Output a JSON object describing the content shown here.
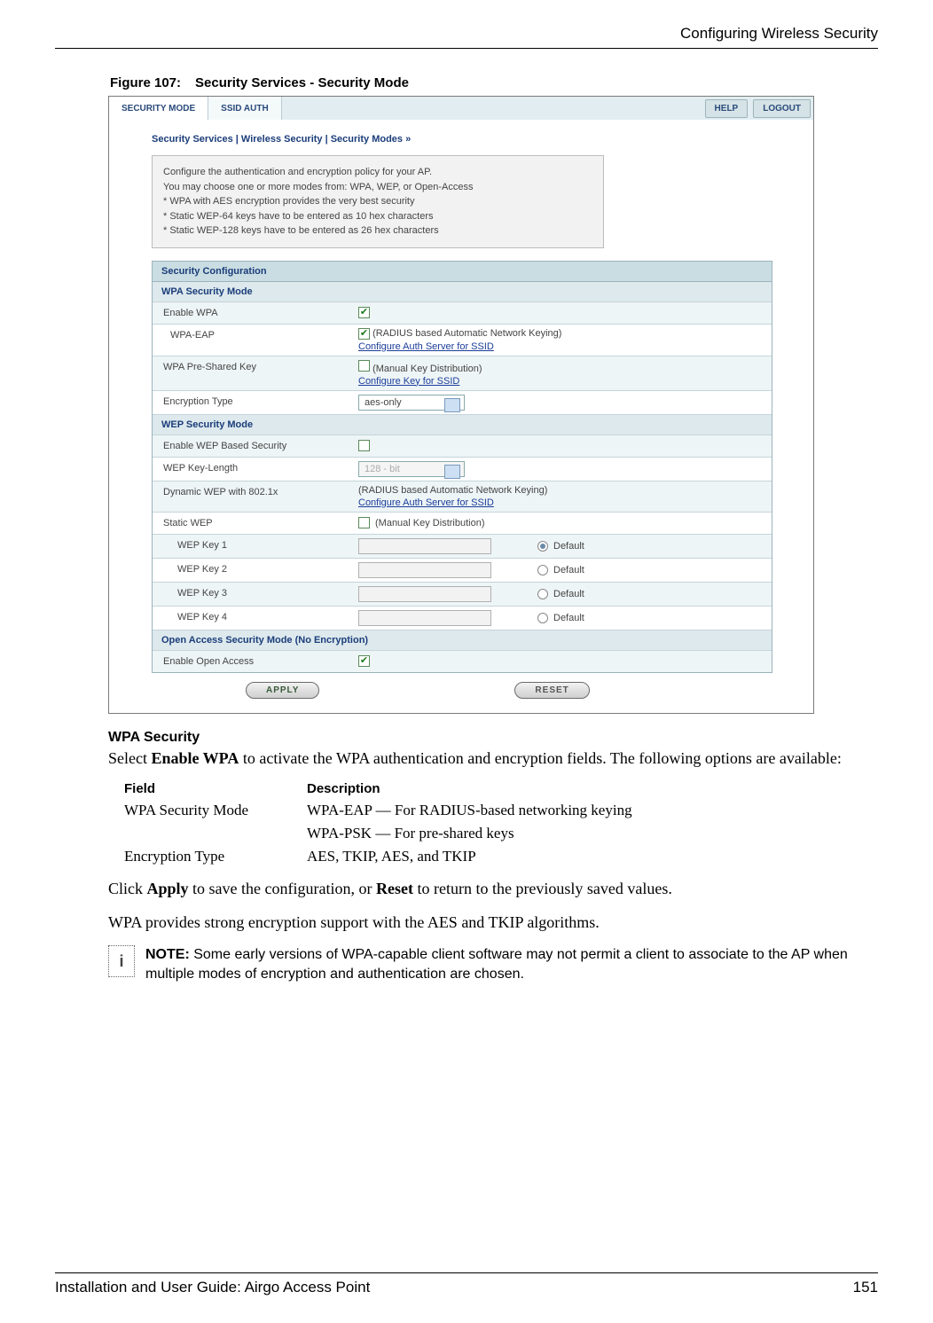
{
  "header": {
    "section_title": "Configuring Wireless Security"
  },
  "figure": {
    "label": "Figure 107:",
    "title": "Security Services - Security Mode"
  },
  "screenshot": {
    "tabs": {
      "active": "SECURITY MODE",
      "other": "SSID AUTH"
    },
    "topbuttons": {
      "help": "HELP",
      "logout": "LOGOUT"
    },
    "breadcrumb": "Security Services | Wireless Security | Security Modes  »",
    "info_lines": [
      "Configure the authentication and encryption policy for your AP.",
      "You may choose one or more modes from: WPA, WEP, or Open-Access",
      "* WPA with AES encryption provides the very best security",
      "* Static WEP-64 keys have to be entered as 10 hex characters",
      "* Static WEP-128 keys have to be entered as 26 hex characters"
    ],
    "hdr_main": "Security Configuration",
    "wpa": {
      "hdr": "WPA Security Mode",
      "enable_label": "Enable WPA",
      "eap_label": "WPA-EAP",
      "eap_note": "(RADIUS based Automatic Network Keying)",
      "eap_link": "Configure Auth Server for SSID",
      "psk_label": "WPA Pre-Shared Key",
      "psk_note": "(Manual Key Distribution)",
      "psk_link": "Configure Key for SSID",
      "enc_label": "Encryption Type",
      "enc_value": "aes-only"
    },
    "wep": {
      "hdr": "WEP Security Mode",
      "enable_label": "Enable WEP Based Security",
      "keylen_label": "WEP Key-Length",
      "keylen_value": "128 - bit",
      "dyn_label": "Dynamic WEP with 802.1x",
      "dyn_note": "(RADIUS based Automatic Network Keying)",
      "dyn_link": "Configure Auth Server for SSID",
      "static_label": "Static WEP",
      "static_note": "(Manual Key Distribution)",
      "k1": "WEP Key 1",
      "k2": "WEP Key 2",
      "k3": "WEP Key 3",
      "k4": "WEP Key 4",
      "default": "Default"
    },
    "open": {
      "hdr": "Open Access Security Mode (No Encryption)",
      "enable_label": "Enable Open Access"
    },
    "buttons": {
      "apply": "APPLY",
      "reset": "RESET"
    }
  },
  "doc": {
    "wpa_title": "WPA Security",
    "wpa_intro_1": "Select ",
    "wpa_intro_bold": "Enable WPA",
    "wpa_intro_2": " to activate the WPA authentication and encryption fields. The following options are available:",
    "th_field": "Field",
    "th_desc": "Description",
    "r1_field": "WPA Security Mode",
    "r1_desc_a": "WPA-EAP — For RADIUS-based networking keying",
    "r1_desc_b": "WPA-PSK — For pre-shared keys",
    "r2_field": "Encryption Type",
    "r2_desc": "AES, TKIP, AES, and TKIP",
    "p_apply_1": "Click ",
    "p_apply_b1": "Apply",
    "p_apply_2": " to save the configuration, or ",
    "p_apply_b2": "Reset",
    "p_apply_3": " to return to the previously saved values.",
    "p_strong": "WPA provides strong encryption support with the AES and TKIP algorithms.",
    "note_label": "NOTE:",
    "note_text": " Some early versions of WPA-capable client software may not permit a client to associate to the AP when multiple modes of encryption and authentication are chosen."
  },
  "footer": {
    "left": "Installation and User Guide: Airgo Access Point",
    "right": "151"
  }
}
